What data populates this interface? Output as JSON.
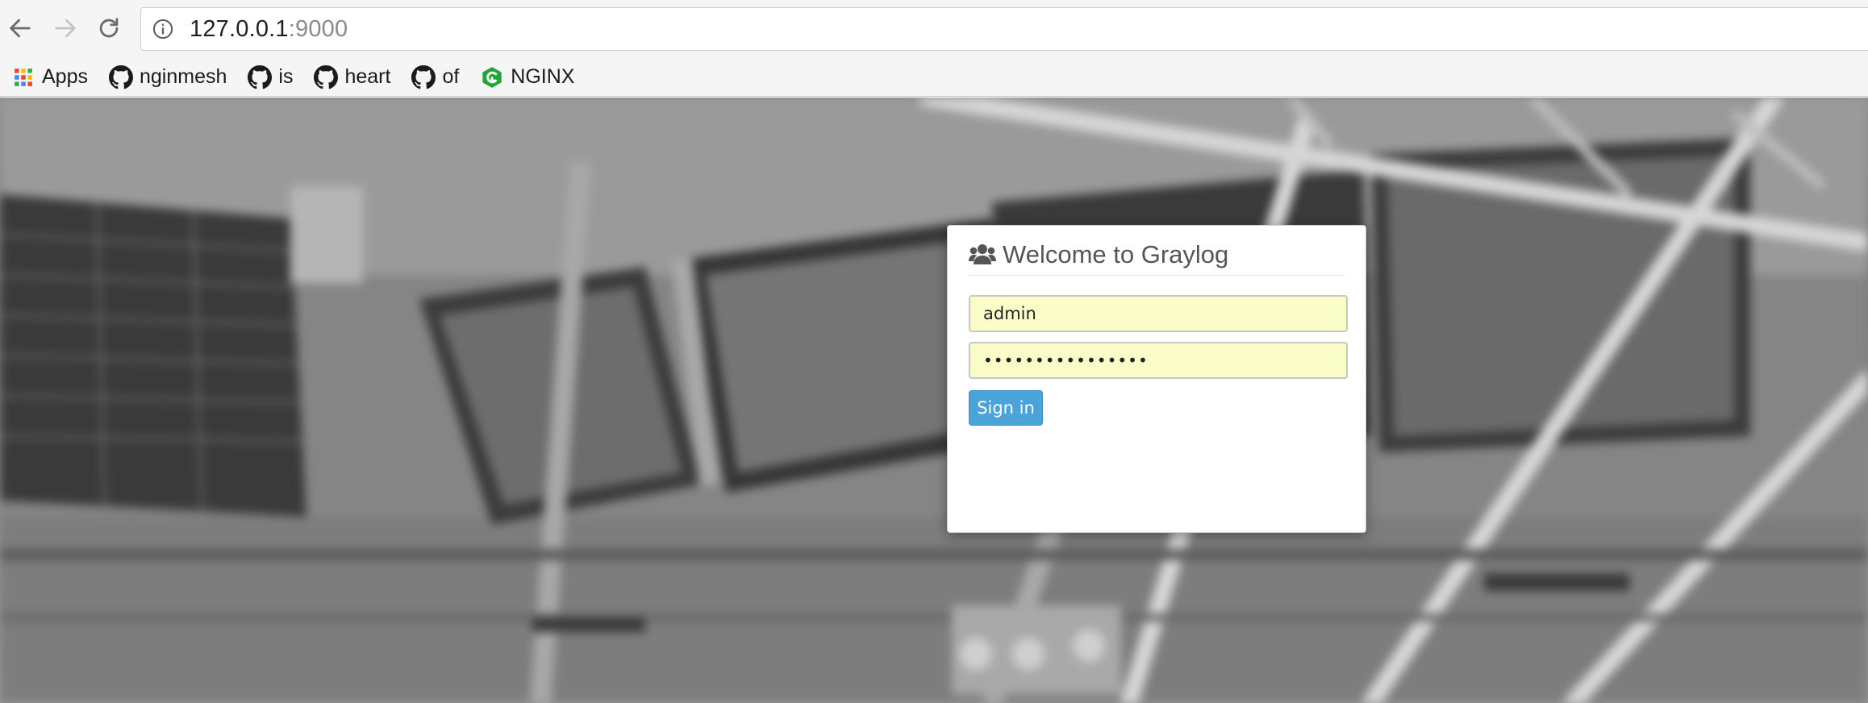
{
  "browser": {
    "url_host": "127.0.0.1",
    "url_port": ":9000",
    "nav": {
      "back_icon": "arrow-left-icon",
      "forward_icon": "arrow-right-icon",
      "reload_icon": "reload-icon",
      "info_icon": "info-circle-icon"
    }
  },
  "bookmarks": [
    {
      "label": "Apps",
      "icon": "apps-grid-icon"
    },
    {
      "label": "nginmesh",
      "icon": "github-icon"
    },
    {
      "label": "is",
      "icon": "github-icon"
    },
    {
      "label": "heart",
      "icon": "github-icon"
    },
    {
      "label": "of",
      "icon": "github-icon"
    },
    {
      "label": "NGINX",
      "icon": "nginx-icon"
    }
  ],
  "login": {
    "title": "Welcome to Graylog",
    "title_icon": "users-icon",
    "username_value": "admin",
    "password_value": "••••••••••••••••",
    "signin_label": "Sign in",
    "field_background": "#fbfdc9",
    "button_color": "#4aa4d9"
  }
}
